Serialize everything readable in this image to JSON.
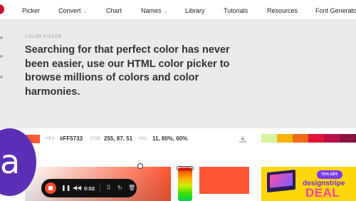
{
  "nav": {
    "items": [
      {
        "label": "Picker"
      },
      {
        "label": "Convert"
      },
      {
        "label": "Chart"
      },
      {
        "label": "Names"
      },
      {
        "label": "Library"
      },
      {
        "label": "Tutorials"
      },
      {
        "label": "Resources"
      },
      {
        "label": "Font Generator"
      }
    ]
  },
  "hero": {
    "eyebrow": "COLOR PICKER",
    "headline": "Searching for that perfect color has never been easier, use our HTML color picker to browse millions of colors and color harmonies."
  },
  "color": {
    "swatch": "#ff5733",
    "hex_label": "HEX",
    "hex_value": "#FF5733",
    "rgb_label": "RGB",
    "rgb_value": "255, 87, 51",
    "hsl_label": "HSL",
    "hsl_value": "11, 80%, 60%"
  },
  "tints": {
    "colors": [
      "#d6f2a3",
      "#f7b500",
      "#ef6b18",
      "#e2133d",
      "#b8114a",
      "#8e1241",
      "#5e1132"
    ]
  },
  "avatar": {
    "letter": "a",
    "color": "#5b2fb5"
  },
  "recorder": {
    "time": "0:02"
  },
  "ad": {
    "badge": "70% OFF",
    "brand": "designstripe",
    "deal": "DEAL"
  }
}
